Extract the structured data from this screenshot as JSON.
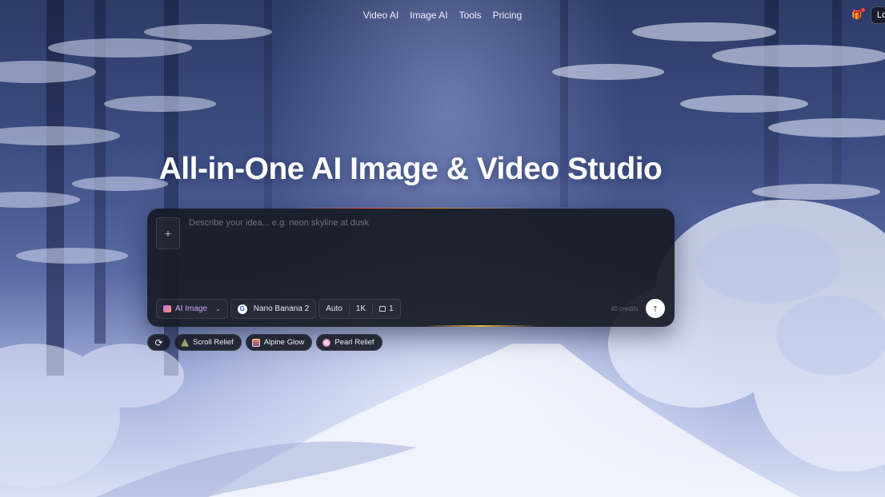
{
  "nav": {
    "items": [
      "Video AI",
      "Image AI",
      "Tools",
      "Pricing"
    ],
    "gift_icon": "gift-icon",
    "login_label": "Lo"
  },
  "hero": {
    "title": "All-in-One AI Image & Video Studio"
  },
  "prompt_panel": {
    "add_label": "+",
    "placeholder": "Describe your idea... e.g. neon skyline at dusk",
    "value": "",
    "mode_label": "AI Image",
    "model_label": "Nano Banana 2",
    "model_icon_letter": "G",
    "aspect_label": "Auto",
    "resolution_label": "1K",
    "count_label": "1",
    "credits_label": "40 credits",
    "send_icon": "arrow-up-icon",
    "send_glyph": "↑"
  },
  "suggestions": {
    "refresh_glyph": "⟳",
    "items": [
      "Scroll Relief",
      "Alpine Glow",
      "Pearl Relief"
    ]
  },
  "colors": {
    "panel_bg": "#171b26",
    "accent_purple": "#c8a8f0",
    "notify_dot": "#ef4444"
  }
}
